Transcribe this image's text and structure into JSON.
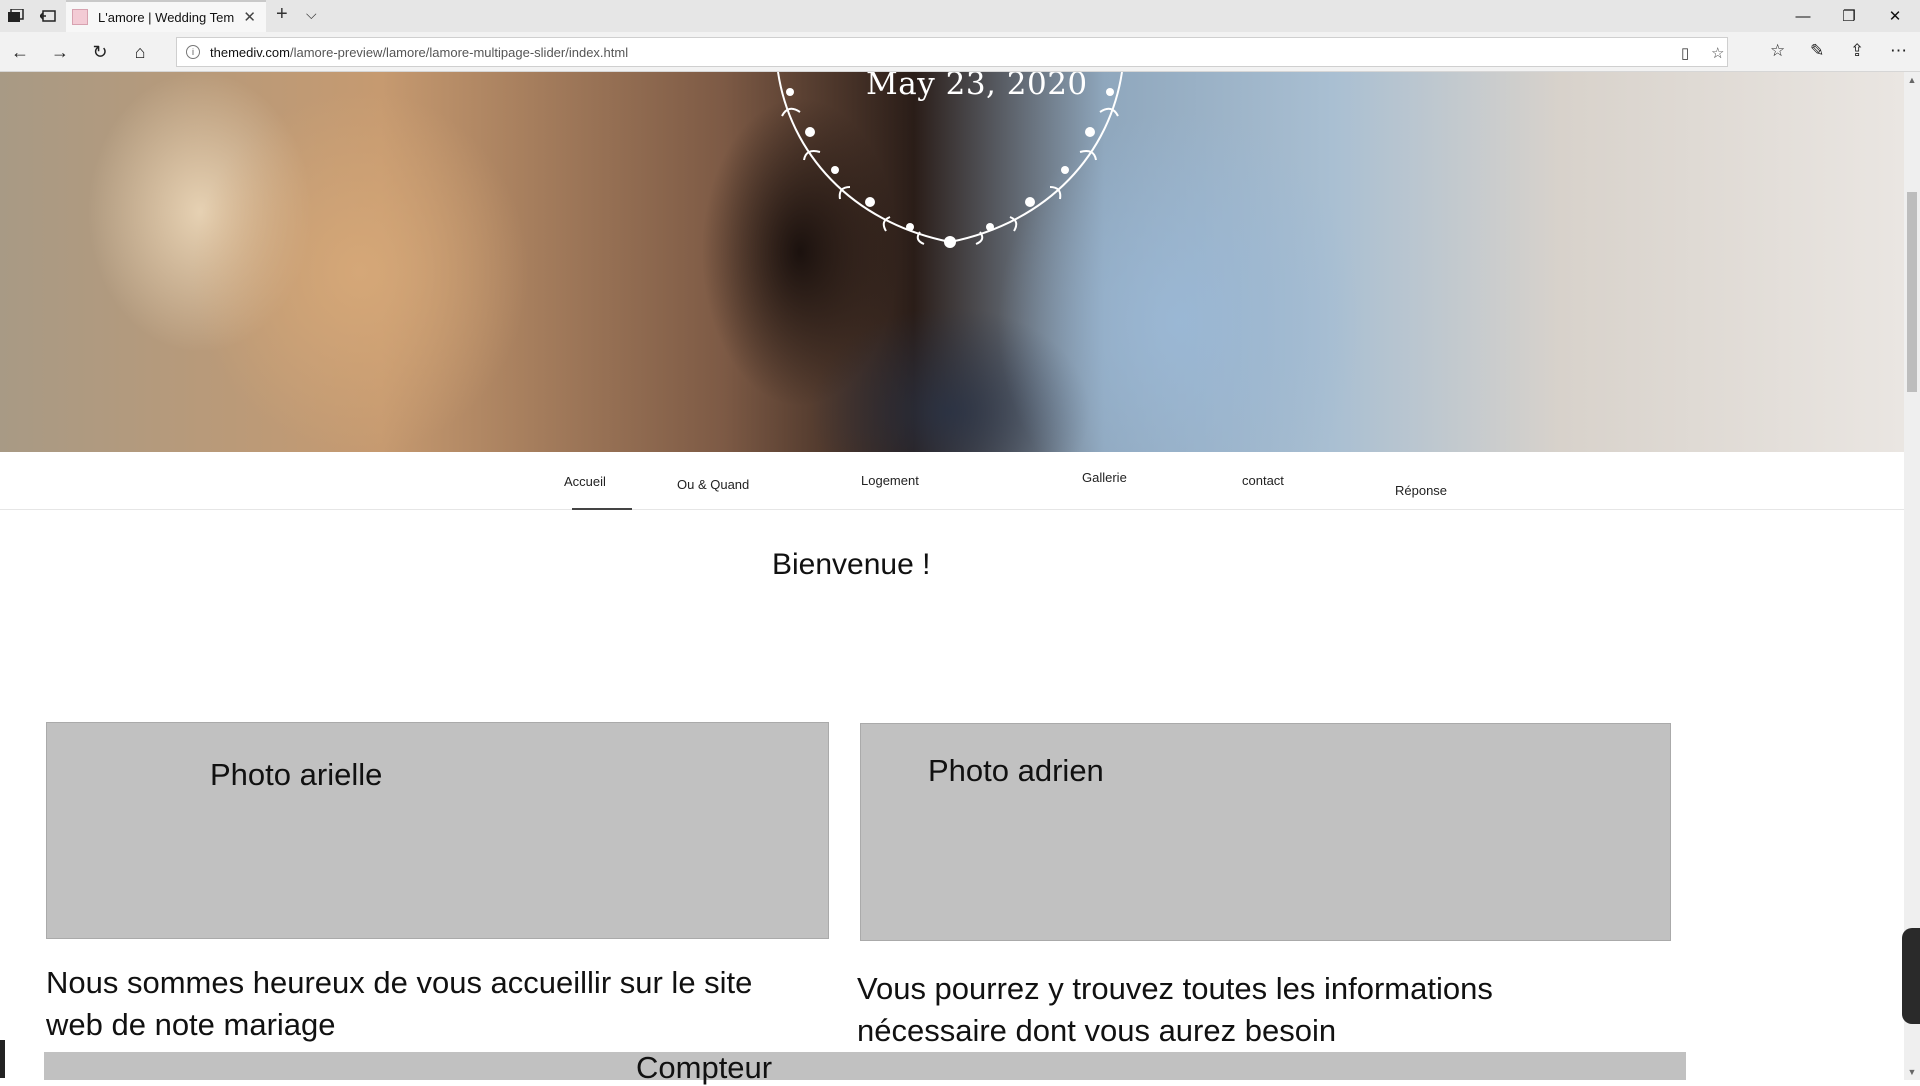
{
  "browser": {
    "tab_title": "L'amore | Wedding Tem",
    "url_host": "themediv.com",
    "url_path": "/lamore-preview/lamore/lamore-multipage-slider/index.html",
    "icons": {
      "tab_actions": "tab-actions-icon",
      "set_aside": "set-aside-tabs-icon",
      "new_tab": "+",
      "tab_menu": "⌵",
      "minimize": "—",
      "restore": "❐",
      "close": "✕",
      "back": "←",
      "forward": "→",
      "refresh": "↻",
      "home": "⌂",
      "reading_view": "▯",
      "favorite": "☆",
      "favorites_hub": "☆",
      "notes": "✎",
      "share": "⇪",
      "more": "⋯"
    }
  },
  "hero": {
    "date": "May 23, 2020"
  },
  "menu": {
    "items": [
      {
        "label": "Accueil",
        "active": true
      },
      {
        "label": "Ou & Quand"
      },
      {
        "label": "Logement"
      },
      {
        "label": "Gallerie"
      },
      {
        "label": "contact"
      },
      {
        "label": "Réponse"
      }
    ]
  },
  "main": {
    "welcome": "Bienvenue !",
    "photo_left_label": "Photo arielle",
    "photo_right_label": "Photo adrien",
    "para_left": "Nous sommes heureux de vous accueillir sur le site web de note mariage",
    "para_right": "Vous pourrez y trouvez toutes les informations nécessaire dont vous aurez besoin",
    "counter_label": "Compteur"
  },
  "colors": {
    "placeholder_gray": "#c1c1c1",
    "text": "#111111"
  }
}
